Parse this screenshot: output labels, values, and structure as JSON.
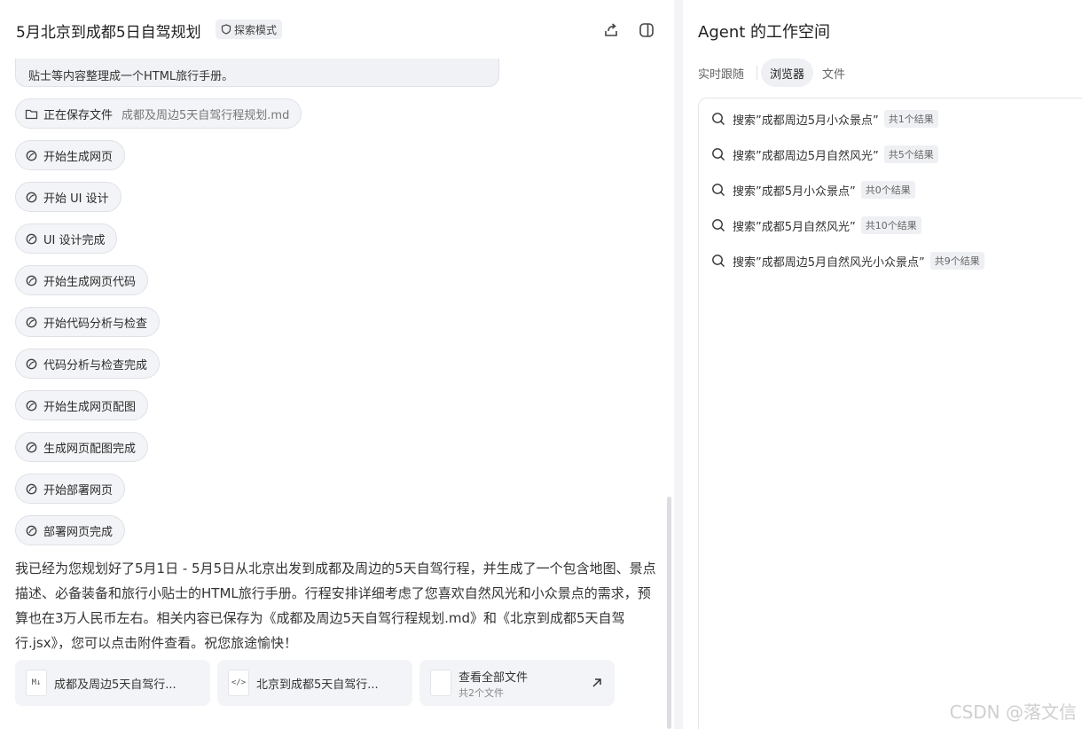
{
  "chat": {
    "title": "5月北京到成都5日自驾规划",
    "mode_badge": "探索模式",
    "bubble_clipped": "…………",
    "bubble_text": "贴士等内容整理成一个HTML旅行手册。",
    "steps": [
      {
        "label": "正在保存文件",
        "sub": "成都及周边5天自驾行程规划.md",
        "icon": "folder-icon"
      },
      {
        "label": "开始生成网页",
        "icon": "spinner-icon"
      },
      {
        "label": "开始 UI 设计",
        "icon": "spinner-icon"
      },
      {
        "label": "UI 设计完成",
        "icon": "spinner-icon"
      },
      {
        "label": "开始生成网页代码",
        "icon": "spinner-icon"
      },
      {
        "label": "开始代码分析与检查",
        "icon": "spinner-icon"
      },
      {
        "label": "代码分析与检查完成",
        "icon": "spinner-icon"
      },
      {
        "label": "开始生成网页配图",
        "icon": "spinner-icon"
      },
      {
        "label": "生成网页配图完成",
        "icon": "spinner-icon"
      },
      {
        "label": "开始部署网页",
        "icon": "spinner-icon"
      },
      {
        "label": "部署网页完成",
        "icon": "spinner-icon"
      }
    ],
    "summary": "我已经为您规划好了5月1日 - 5月5日从北京出发到成都及周边的5天自驾行程，并生成了一个包含地图、景点描述、必备装备和旅行小贴士的HTML旅行手册。行程安排详细考虑了您喜欢自然风光和小众景点的需求，预算也在3万人民币左右。相关内容已保存为《成都及周边5天自驾行程规划.md》和《北京到成都5天自驾行.jsx》，您可以点击附件查看。祝您旅途愉快！",
    "attachments": [
      {
        "icon": "markdown-file-icon",
        "icon_text": "M↓",
        "name": "成都及周边5天自驾行..."
      },
      {
        "icon": "code-file-icon",
        "icon_text": "</>",
        "name": "北京到成都5天自驾行..."
      }
    ],
    "view_all": {
      "title": "查看全部文件",
      "sub": "共2个文件"
    }
  },
  "workspace": {
    "title": "Agent 的工作空间",
    "tabs": [
      {
        "label": "实时跟随",
        "active": false
      },
      {
        "label": "浏览器",
        "active": true
      },
      {
        "label": "文件",
        "active": false
      }
    ],
    "searches": [
      {
        "query": "搜索”成都周边5月小众景点”",
        "count": "共1个结果"
      },
      {
        "query": "搜索”成都周边5月自然风光”",
        "count": "共5个结果"
      },
      {
        "query": "搜索”成都5月小众景点”",
        "count": "共0个结果"
      },
      {
        "query": "搜索”成都5月自然风光”",
        "count": "共10个结果"
      },
      {
        "query": "搜索”成都周边5月自然风光小众景点”",
        "count": "共9个结果"
      }
    ]
  },
  "watermark": "CSDN @落文信"
}
